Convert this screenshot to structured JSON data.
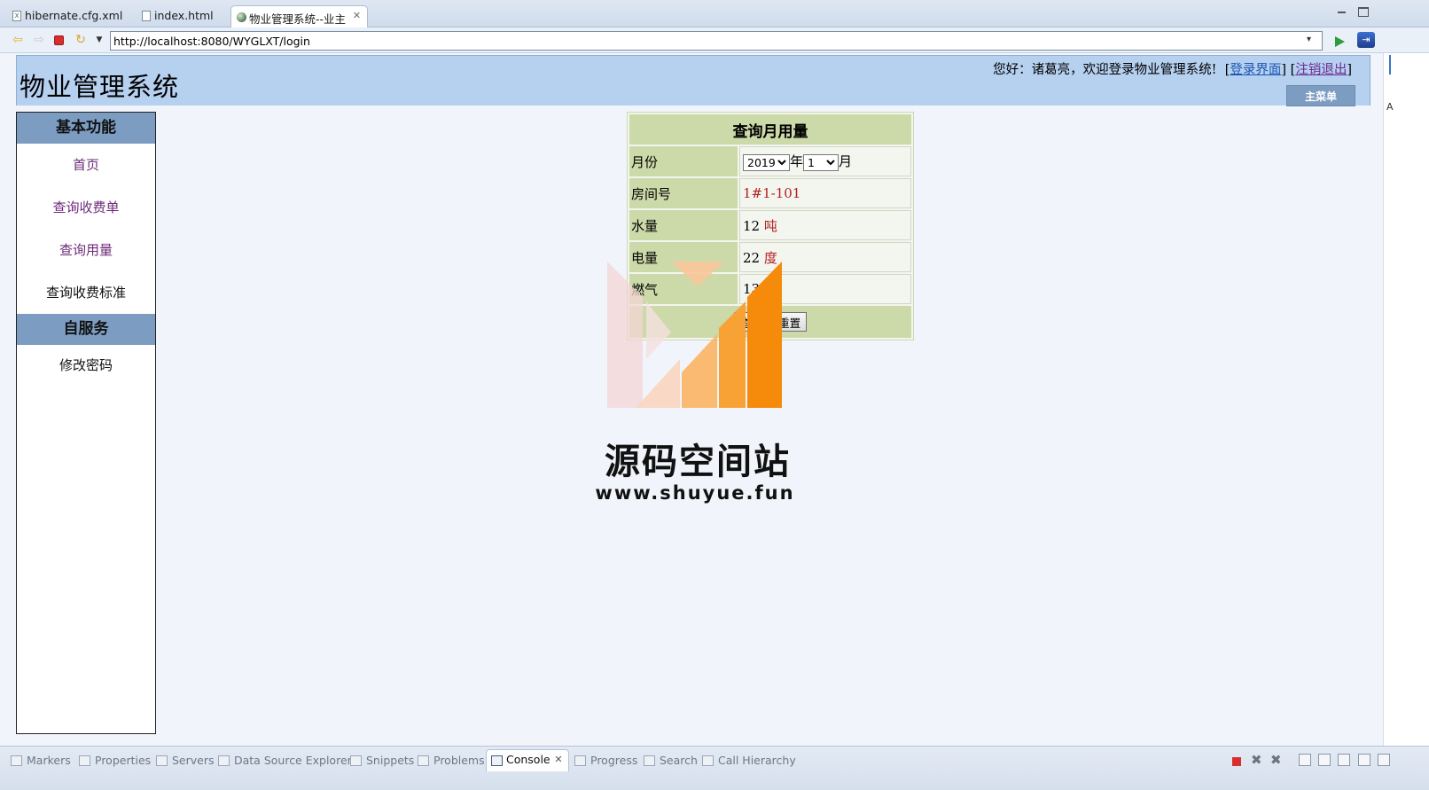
{
  "editor_tabs": [
    {
      "label": "hibernate.cfg.xml",
      "icon": "xml-file-icon",
      "active": false
    },
    {
      "label": "index.html",
      "icon": "html-file-icon",
      "active": false
    },
    {
      "label": "物业管理系统--业主",
      "icon": "globe-icon",
      "active": true
    }
  ],
  "url_bar": {
    "url": "http://localhost:8080/WYGLXT/login"
  },
  "header": {
    "title": "物业管理系统",
    "welcome_prefix": "您好：诸葛亮，欢迎登录物业管理系统!",
    "login_link": "登录界面",
    "logout_link": "注销退出",
    "main_menu": "主菜单"
  },
  "sidebar": {
    "section1": "基本功能",
    "items1": [
      "首页",
      "查询收费单",
      "查询用量",
      "查询收费标准"
    ],
    "section2": "自服务",
    "items2": [
      "修改密码"
    ]
  },
  "query": {
    "title": "查询月用量",
    "month_label": "月份",
    "year_value": "2019",
    "year_unit": "年",
    "month_value": "1",
    "month_unit": "月",
    "room_label": "房间号",
    "room_value": "1#1-101",
    "water_label": "水量",
    "water_value": "12",
    "water_unit": "吨",
    "elec_label": "电量",
    "elec_value": "22",
    "elec_unit": "度",
    "gas_label": "燃气",
    "gas_value": "13",
    "query_button": "查询",
    "reset_button": "重置"
  },
  "watermark": {
    "title": "源码空间站",
    "url": "www.shuyue.fun"
  },
  "bottom_tabs": [
    {
      "label": "Markers",
      "icon": "markers-icon"
    },
    {
      "label": "Properties",
      "icon": "properties-icon"
    },
    {
      "label": "Servers",
      "icon": "servers-icon"
    },
    {
      "label": "Data Source Explorer",
      "icon": "data-source-icon"
    },
    {
      "label": "Snippets",
      "icon": "snippets-icon"
    },
    {
      "label": "Problems",
      "icon": "problems-icon"
    },
    {
      "label": "Console",
      "icon": "console-icon",
      "active": true
    },
    {
      "label": "Progress",
      "icon": "progress-icon"
    },
    {
      "label": "Search",
      "icon": "search-icon"
    },
    {
      "label": "Call Hierarchy",
      "icon": "call-hierarchy-icon"
    }
  ],
  "colors": {
    "header_bg": "#b6d0f0",
    "sidebar_section_bg": "#7c9cc2",
    "table_label_bg": "#ccd9a8",
    "link_visited": "#6d2a7a",
    "unit_red": "#b52020"
  }
}
